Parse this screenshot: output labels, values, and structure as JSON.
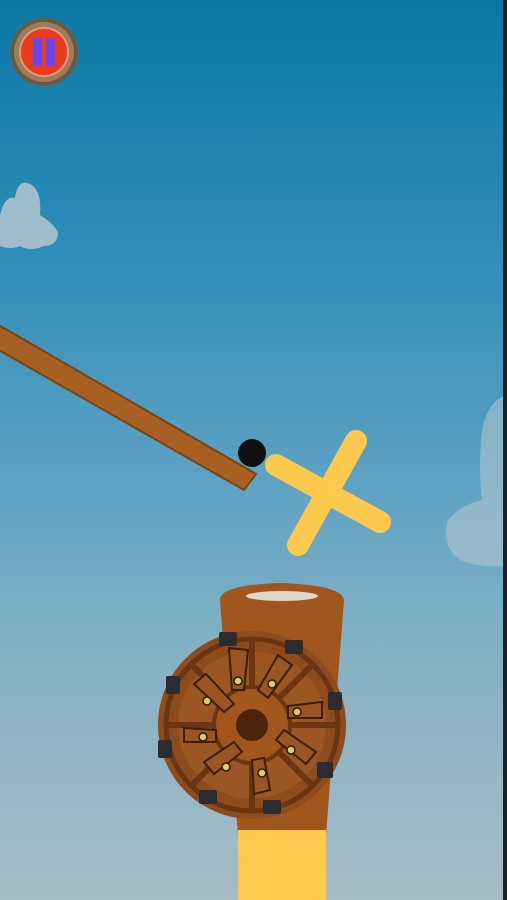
{
  "colors": {
    "sky_top": "#0b78a6",
    "sky_bottom": "#a6bcc6",
    "plank": "#a85f22",
    "plank_edge": "#7a4315",
    "x_rotor": "#ffc94d",
    "ball": "#111111",
    "cannon_body": "#a0561c",
    "cannon_dark": "#6b3410",
    "wheel_wood": "#9a5523",
    "wheel_rim_dark": "#5e2f0f",
    "bolt": "#e8c766",
    "clamp": "#2c2c30",
    "base_yellow": "#ffc94d",
    "pause_outer": "#8a6a4a",
    "pause_inner_red": "#e83b1c",
    "pause_bars": "#6b46e8",
    "cloud": "#b8c4cc"
  },
  "hud": {
    "pause_icon": "pause-icon"
  },
  "objects": {
    "plank": "plank",
    "ball": "ball",
    "rotor": "x-rotor",
    "cannon": "cannon",
    "wheel": "spoked-wheel",
    "base": "yellow-base",
    "clouds": [
      "cloud-left",
      "cloud-right"
    ]
  }
}
